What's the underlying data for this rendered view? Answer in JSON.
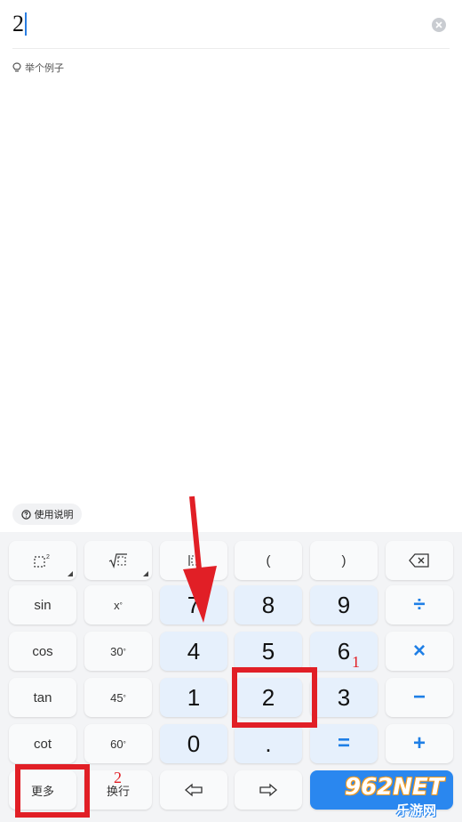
{
  "input": {
    "value": "2",
    "clear_icon": "clear-circle-icon"
  },
  "example": {
    "icon": "lightbulb-icon",
    "label": "举个例子"
  },
  "help": {
    "icon": "question-circle-icon",
    "label": "使用说明"
  },
  "keyboard": {
    "rows": [
      [
        "square-template",
        "sqrt-template",
        "bracket-template",
        "(",
        ")",
        "backspace"
      ],
      [
        "sin",
        "x°",
        "7",
        "8",
        "9",
        "÷"
      ],
      [
        "cos",
        "30°",
        "4",
        "5",
        "6",
        "×"
      ],
      [
        "tan",
        "45°",
        "1",
        "2",
        "3",
        "−"
      ],
      [
        "cot",
        "60°",
        "0",
        ".",
        "=",
        "+"
      ],
      [
        "更多",
        "换行",
        "arrow-left",
        "arrow-right",
        "submit"
      ]
    ],
    "labels": {
      "open_paren": "(",
      "close_paren": ")",
      "sin": "sin",
      "cos": "cos",
      "tan": "tan",
      "cot": "cot",
      "x_deg": "x",
      "deg_30": "30",
      "deg_45": "45",
      "deg_60": "60",
      "deg_sign": "°",
      "n7": "7",
      "n8": "8",
      "n9": "9",
      "n4": "4",
      "n5": "5",
      "n6": "6",
      "n1": "1",
      "n2": "2",
      "n3": "3",
      "n0": "0",
      "dot": ".",
      "divide": "÷",
      "multiply": "×",
      "minus": "−",
      "equals": "=",
      "plus": "+",
      "more": "更多",
      "newline": "换行"
    }
  },
  "annotations": {
    "label_1": "1",
    "label_2": "2"
  },
  "watermark": {
    "main": "962NET",
    "sub": "乐游网"
  },
  "colors": {
    "accent": "#2a87ef",
    "num_key_bg": "#e6f0fc",
    "annotation": "#e11f26"
  }
}
